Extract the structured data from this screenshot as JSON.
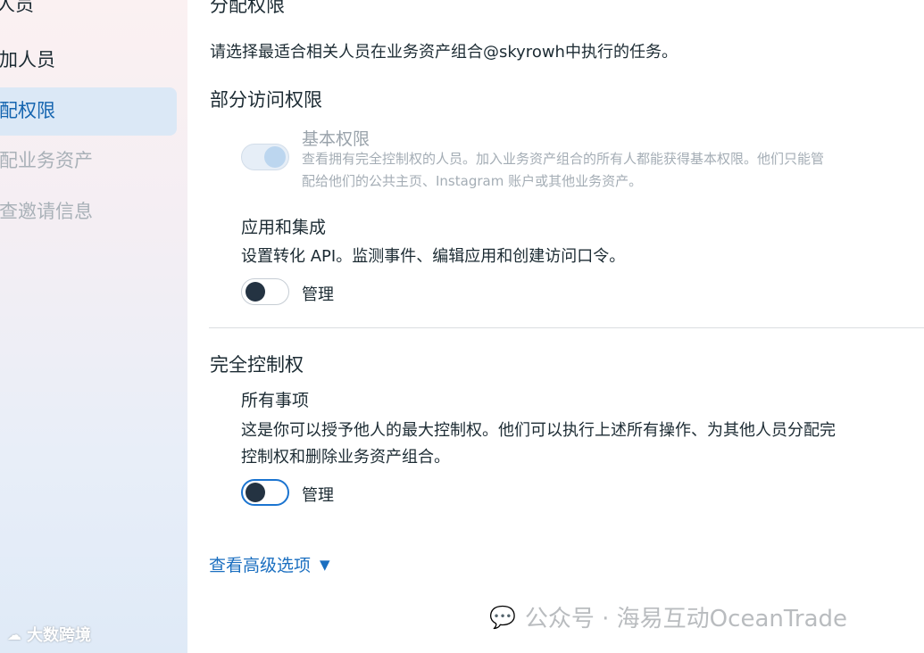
{
  "sidebar": {
    "items": [
      {
        "label": "人员",
        "state": "normal"
      },
      {
        "label": "加人员",
        "state": "normal"
      },
      {
        "label": "配权限",
        "state": "active"
      },
      {
        "label": "配业务资产",
        "state": "disabled"
      },
      {
        "label": "查邀请信息",
        "state": "disabled"
      }
    ],
    "brand": {
      "icon": "cloud-logo-icon",
      "text": "大数跨境"
    }
  },
  "main": {
    "title": "分配权限",
    "intro": "请选择最适合相关人员在业务资产组合@skyrowh中执行的任务。",
    "partial": {
      "heading": "部分访问权限",
      "basic": {
        "title": "基本权限",
        "desc_line1": "查看拥有完全控制权的人员。加入业务资产组合的所有人都能获得基本权限。他们只能管",
        "desc_line2": "配给他们的公共主页、Instagram 账户或其他业务资产。",
        "toggle": "on-disabled"
      },
      "apps": {
        "title": "应用和集成",
        "desc": "设置转化 API。监测事件、编辑应用和创建访问口令。",
        "toggle_label": "管理",
        "toggle": "off"
      }
    },
    "full": {
      "heading": "完全控制权",
      "all": {
        "title": "所有事项",
        "desc_line1": "这是你可以授予他人的最大控制权。他们可以执行上述所有操作、为其他人员分配完",
        "desc_line2": "控制权和删除业务资产组合。",
        "toggle_label": "管理",
        "toggle": "off-focused"
      }
    },
    "advanced_link": "查看高级选项"
  },
  "watermark": {
    "icon": "wechat-icon",
    "text": "公众号 · 海易互动OceanTrade"
  }
}
